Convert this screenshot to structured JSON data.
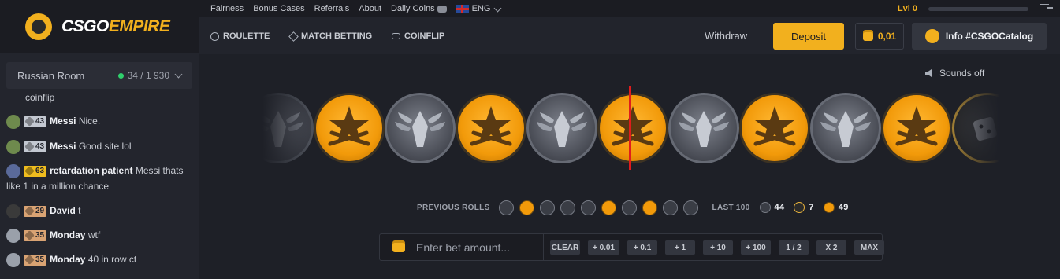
{
  "brand": {
    "name_a": "CSGO",
    "name_b": "EMPIRE"
  },
  "topnav": {
    "links": [
      "Fairness",
      "Bonus Cases",
      "Referrals",
      "About",
      "Daily Coins"
    ],
    "language": "ENG",
    "level": "Lvl 0"
  },
  "games": [
    "ROULETTE",
    "MATCH BETTING",
    "COINFLIP"
  ],
  "header": {
    "withdraw": "Withdraw",
    "deposit": "Deposit",
    "balance": "0,01",
    "info": "Info #CSGOCatalog"
  },
  "chat": {
    "room": "Russian Room",
    "online": "34 / 1 930",
    "fragment": "coinflip",
    "messages": [
      {
        "level": "43",
        "tier": "silver",
        "user": "Messi",
        "text": "Nice."
      },
      {
        "level": "43",
        "tier": "silver",
        "user": "Messi",
        "text": "Good site lol"
      },
      {
        "level": "63",
        "tier": "gold",
        "user": "retardation patient",
        "text": "Messi thats like 1 in a million chance"
      },
      {
        "level": "29",
        "tier": "bronze",
        "user": "David",
        "text": "t"
      },
      {
        "level": "35",
        "tier": "bronze",
        "user": "Monday",
        "text": "wtf"
      },
      {
        "level": "35",
        "tier": "bronze",
        "user": "Monday",
        "text": "40 in row ct"
      }
    ]
  },
  "sounds": "Sounds off",
  "roll": [
    "ct",
    "t",
    "ct",
    "t",
    "ct",
    "t",
    "ct",
    "t",
    "ct",
    "t",
    "bonus"
  ],
  "previous_rolls": {
    "label": "PREVIOUS ROLLS",
    "items": [
      "ct",
      "t",
      "ct",
      "ct",
      "ct",
      "t",
      "ct",
      "t",
      "ct",
      "ct"
    ]
  },
  "last100": {
    "label": "LAST 100",
    "ct": "44",
    "bonus": "7",
    "t": "49"
  },
  "bet": {
    "placeholder": "Enter bet amount...",
    "buttons": [
      "CLEAR",
      "+ 0.01",
      "+ 0.1",
      "+ 1",
      "+ 10",
      "+ 100",
      "1 / 2",
      "X 2",
      "MAX"
    ]
  },
  "colors": {
    "accent": "#f2b01e",
    "marker": "#e01c1c",
    "online": "#2fd06c"
  }
}
